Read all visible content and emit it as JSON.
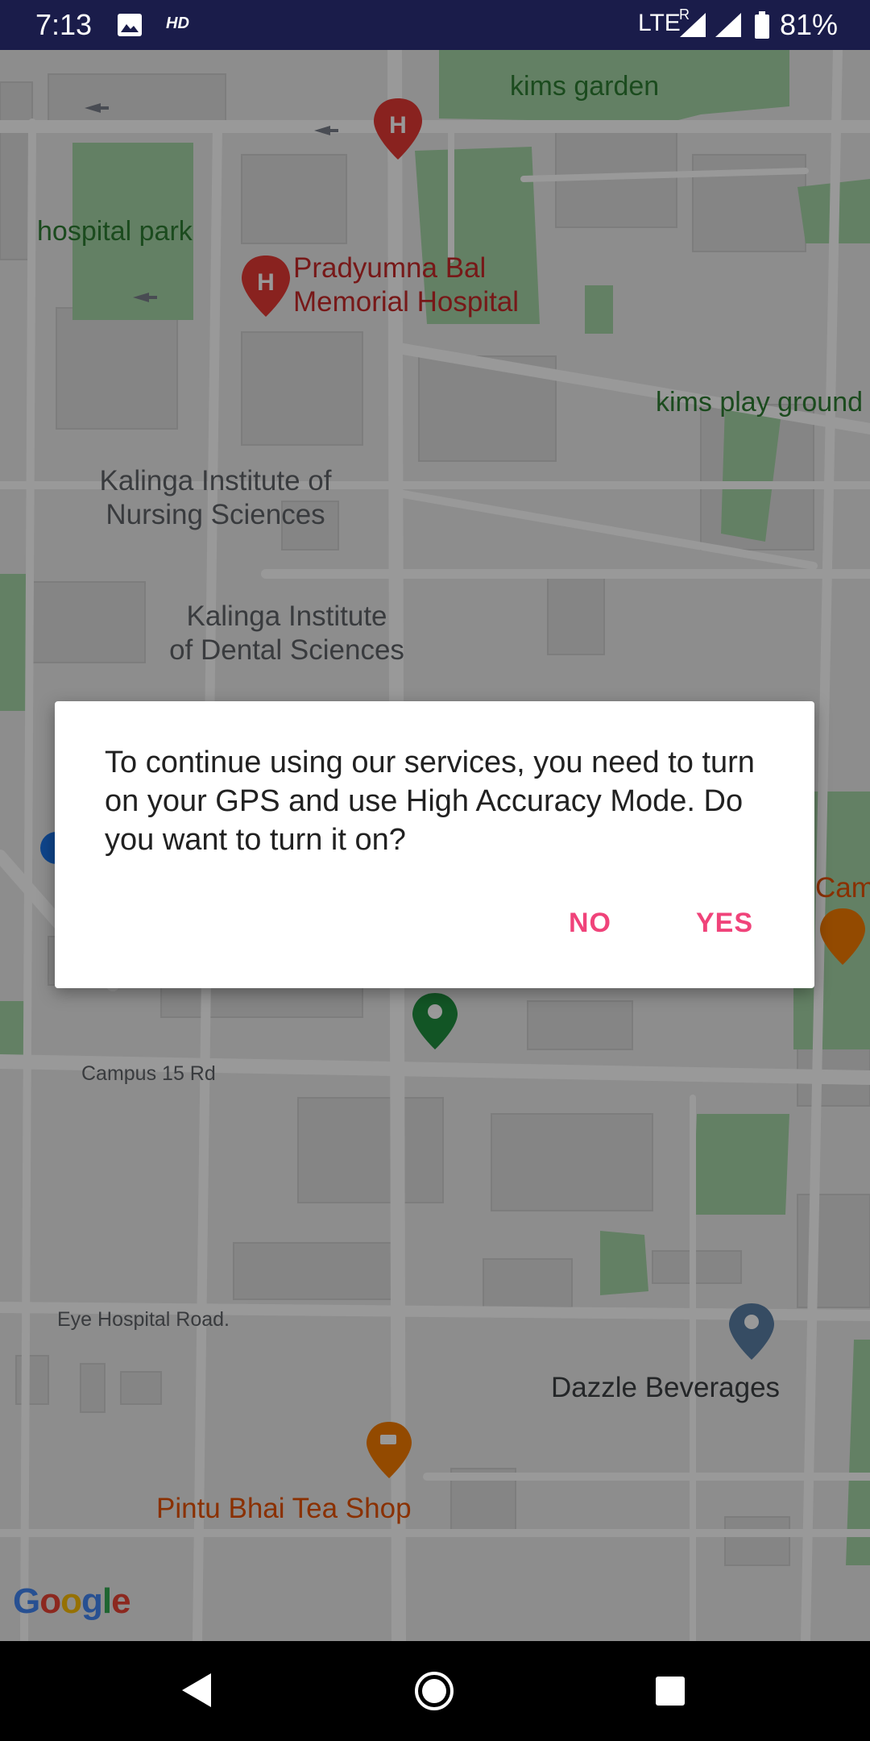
{
  "status_bar": {
    "time": "7:13",
    "hd": "HD",
    "network": "LTE",
    "roaming": "R",
    "battery": "81%"
  },
  "map": {
    "places": {
      "kims_garden": "kims garden",
      "hospital_park": "hospital park",
      "hospital_name_line1": "Pradyumna Bal",
      "hospital_name_line2": "Memorial Hospital",
      "kims_play_ground": "kims play ground",
      "nursing_line1": "Kalinga Institute of",
      "nursing_line2": "Nursing Sciences",
      "dental_line1": "Kalinga Institute",
      "dental_line2": "of Dental Sciences",
      "campus_road": "Campus 15 Rd",
      "eye_hospital_road": "Eye Hospital Road.",
      "dazzle": "Dazzle Beverages",
      "tea_shop": "Pintu Bhai Tea Shop",
      "cam_partial": "Cam"
    },
    "attribution": "Google",
    "colors": {
      "park": "#a5d6a7",
      "hospital_pin": "#e53935",
      "location_pin": "#1e8e3e",
      "food_pin": "#f57c00",
      "place_pin": "#5b7fa6"
    }
  },
  "dialog": {
    "message": "To continue using our services, you need to turn on your GPS and use High Accuracy Mode. Do you want to turn it on?",
    "no_label": "NO",
    "yes_label": "YES",
    "accent": "#f0437a"
  },
  "nav_bar": {
    "back": "back-icon",
    "home": "home-icon",
    "recents": "recents-icon"
  }
}
